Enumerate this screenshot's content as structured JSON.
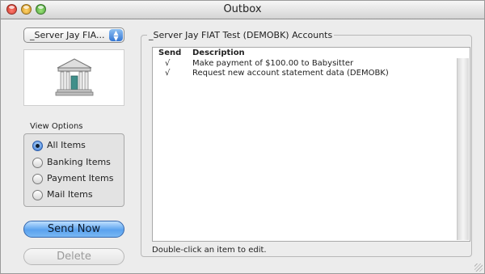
{
  "window": {
    "title": "Outbox"
  },
  "sidebar": {
    "account_popup": "_Server Jay FIA...",
    "bank_icon": "bank-building-icon",
    "view_options": {
      "legend": "View Options",
      "selected": "All Items",
      "options": [
        "All Items",
        "Banking Items",
        "Payment Items",
        "Mail Items"
      ]
    },
    "send_button": "Send Now",
    "delete_button": "Delete"
  },
  "main": {
    "group_title": "_Server Jay FIAT Test (DEMOBK) Accounts",
    "columns": {
      "send": "Send",
      "description": "Description"
    },
    "rows": [
      {
        "send": "√",
        "description": "Make payment of $100.00 to Babysitter"
      },
      {
        "send": "√",
        "description": "Request new account statement data (DEMOBK)"
      }
    ],
    "hint": "Double-click an item to edit."
  }
}
